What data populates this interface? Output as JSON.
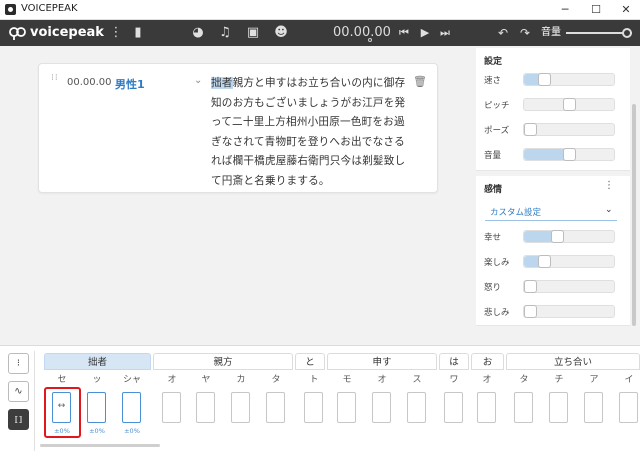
{
  "window": {
    "title": "VOICEPEAK",
    "minimize": "─",
    "maximize": "☐",
    "close": "✕"
  },
  "toolbar": {
    "brand": "voicepeak",
    "timecode": "00.00.00",
    "volume_label": "音量",
    "icons": [
      "logo-icon",
      "menu-dots-icon",
      "book-icon",
      "gauge-icon",
      "music-icon",
      "user-image-icon",
      "emoji-icon",
      "skip-back-icon",
      "play-icon",
      "skip-forward-icon",
      "undo-icon",
      "redo-icon"
    ],
    "glyphs": {
      "menu": "⋮",
      "book": "▮",
      "gauge": "◕",
      "music": "♫",
      "userimg": "▣",
      "emoji": "☻",
      "skip_back": "⏮",
      "play": "▶",
      "skip_fwd": "⏭",
      "undo": "↶",
      "redo": "↷"
    }
  },
  "editor": {
    "block": {
      "time": "00.00.00",
      "speaker": "男性1",
      "highlight": "拙者",
      "text": "親方と申すはお立ち合いの内に御存知のお方もございましょうがお江戸を発って二十里上方相州小田原一色町をお過ぎなされて青物町を登りへお出でなさるれば欄干橋虎屋藤右衛門只今は剃髪致して円斎と名乗りまする。",
      "chevron": "⌄",
      "trash": "🗑"
    }
  },
  "settings": {
    "title": "設定",
    "sliders": [
      {
        "label": "速さ",
        "value": 0.18,
        "filled": true
      },
      {
        "label": "ピッチ",
        "value": 0.5,
        "filled": false
      },
      {
        "label": "ポーズ",
        "value": 0.0,
        "filled": false
      },
      {
        "label": "音量",
        "value": 0.5,
        "filled": true
      }
    ]
  },
  "emotion": {
    "title": "感情",
    "menu": "⋮",
    "preset": "カスタム設定",
    "preset_chevron": "⌄",
    "sliders": [
      {
        "label": "幸せ",
        "value": 0.35,
        "filled": true
      },
      {
        "label": "楽しみ",
        "value": 0.18,
        "filled": true
      },
      {
        "label": "怒り",
        "value": 0.0,
        "filled": false
      },
      {
        "label": "悲しみ",
        "value": 0.0,
        "filled": false
      }
    ]
  },
  "phonemes": {
    "tools": [
      "phoneme-tool",
      "curve-tool",
      "length-tool"
    ],
    "tool_glyphs": [
      "⁝",
      "∿",
      "⟦⟧"
    ],
    "groups": [
      {
        "label": "拙者",
        "selected": true
      },
      {
        "label": "親方",
        "selected": false
      },
      {
        "label": "と",
        "selected": false
      },
      {
        "label": "申す",
        "selected": false
      },
      {
        "label": "は",
        "selected": false
      },
      {
        "label": "お",
        "selected": false
      },
      {
        "label": "立ち合い",
        "selected": false
      }
    ],
    "kana": [
      "セ",
      "ッ",
      "シャ",
      "オ",
      "ヤ",
      "カ",
      "タ",
      "ト",
      "モ",
      "オ",
      "ス",
      "ワ",
      "オ",
      "タ",
      "チ",
      "ア",
      "イ"
    ],
    "values": [
      "±0%",
      "±0%",
      "±0%"
    ],
    "length_glyph": "↔"
  }
}
